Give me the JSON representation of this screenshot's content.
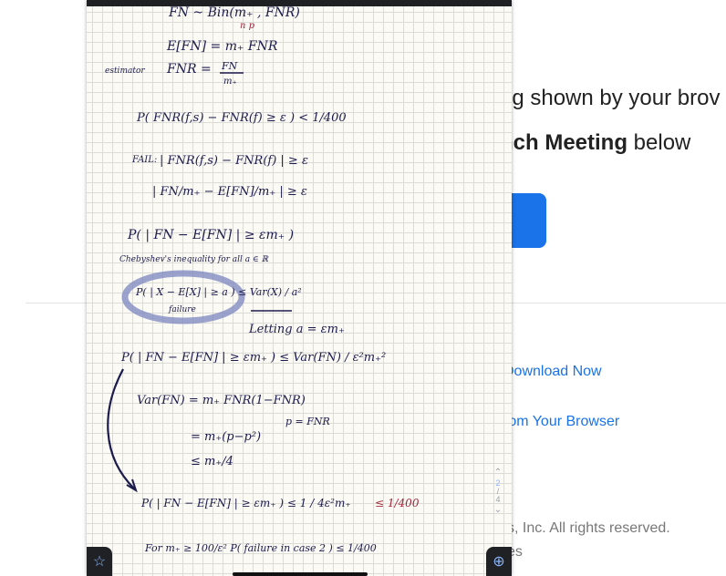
{
  "background_page": {
    "heading_fragment": "og shown by your brov",
    "instruction_prefix": "nch Meeting",
    "instruction_suffix": " below",
    "link_download": "Download Now",
    "link_browser": "rom Your Browser",
    "copyright": "s, Inc. All rights reserved.",
    "copyright_line2": "es"
  },
  "notes": {
    "line_top": "FN ~ Bin(m₊ , FNR)",
    "line_top_sub": "n   p",
    "expectation": "E[FN] = m₊ FNR",
    "estimator_label": "estimator",
    "estimator": "FNR =",
    "estimator_num": "FN",
    "estimator_den": "m₊",
    "prob_bound": "P( FNR(f,s) − FNR(f) ≥ ε ) < 1/400",
    "fail_label": "FAIL:",
    "fail_expr": "| FNR(f,s) − FNR(f) | ≥ ε",
    "fail_expr2": "| FN/m₊ − E[FN]/m₊ | ≥ ε",
    "prob_expr": "P( | FN − E[FN] | ≥ εm₊ )",
    "chebyshev_note": "Chebyshev's inequality   for all a ∈ ℝ",
    "chebyshev": "P( | X − E[X] | ≥ a ) ≤ Var(X) / a²",
    "failure_label": "failure",
    "letting": "Letting  a = εm₊",
    "prob_expr2": "P( | FN − E[FN] | ≥ εm₊ ) ≤ Var(FN) / ε²m₊²",
    "var_line1": "Var(FN) = m₊ FNR(1−FNR)",
    "var_line2": "= m₊(p−p²)",
    "p_def": "p = FNR",
    "var_line3": "≤ m₊/4",
    "final_bound": "P( | FN − E[FN] | ≥ εm₊ ) ≤ 1 / 4ε²m₊",
    "final_red": "≤ 1/400",
    "for_line": "For  m₊ ≥ 100/ε²     P( failure in case 2 ) ≤ 1/400"
  },
  "page_nav": {
    "current": "2",
    "separator": "/",
    "total": "4"
  },
  "icons": {
    "left_corner": "star-icon",
    "right_corner": "zoom-in-icon"
  },
  "colors": {
    "ink": "#1c1b4d",
    "red_ink": "#a3243a",
    "highlight": "#7b86c0",
    "link": "#1a73e8"
  }
}
